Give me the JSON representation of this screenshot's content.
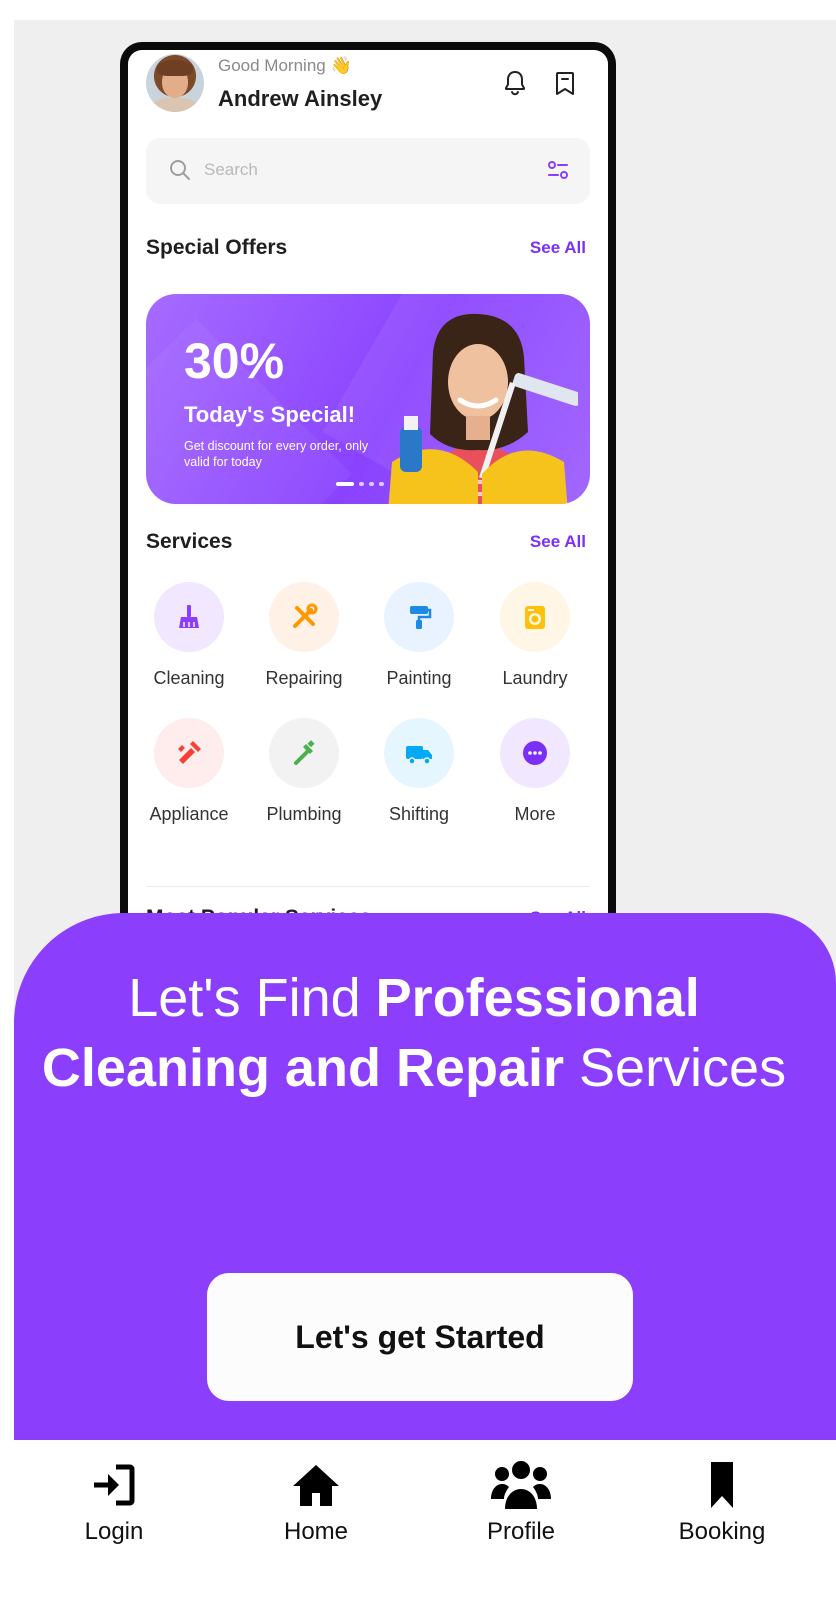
{
  "mockup": {
    "greeting": "Good Morning 👋",
    "user_name": "Andrew Ainsley",
    "search_placeholder": "Search",
    "special_offers_title": "Special Offers",
    "special_offers_see_all": "See All",
    "banner": {
      "percent": "30%",
      "title": "Today's Special!",
      "description": "Get discount for every order, only valid for today"
    },
    "services_title": "Services",
    "services_see_all": "See All",
    "services": [
      {
        "label": "Cleaning",
        "icon": "broom-icon",
        "bg": "#f1e8ff",
        "color": "#8b3ffc"
      },
      {
        "label": "Repairing",
        "icon": "tools-icon",
        "bg": "#fff1e6",
        "color": "#ff9800"
      },
      {
        "label": "Painting",
        "icon": "paint-roller-icon",
        "bg": "#e8f3ff",
        "color": "#1e88e5"
      },
      {
        "label": "Laundry",
        "icon": "washing-machine-icon",
        "bg": "#fff6e5",
        "color": "#ffc107"
      },
      {
        "label": "Appliance",
        "icon": "appliance-icon",
        "bg": "#ffecec",
        "color": "#f44336"
      },
      {
        "label": "Plumbing",
        "icon": "wrench-icon",
        "bg": "#f2f2f2",
        "color": "#4caf50"
      },
      {
        "label": "Shifting",
        "icon": "truck-icon",
        "bg": "#e6f6ff",
        "color": "#03a9f4"
      },
      {
        "label": "More",
        "icon": "more-icon",
        "bg": "#f1e8ff",
        "color": "#7b2ff7"
      }
    ],
    "popular_title": "Most Popular Services",
    "popular_see_all": "See All"
  },
  "hero": {
    "line1_regular": "Let's Find ",
    "line1_bold": "Professional",
    "line2_bold": "Cleaning and Repair",
    "line2_regular": " Services",
    "cta_label": "Let's get Started"
  },
  "nav": [
    {
      "label": "Login",
      "icon": "login-icon"
    },
    {
      "label": "Home",
      "icon": "home-icon"
    },
    {
      "label": "Profile",
      "icon": "users-icon"
    },
    {
      "label": "Booking",
      "icon": "bookmark-icon"
    }
  ],
  "colors": {
    "accent": "#8b3ffc",
    "link": "#7b2ff7"
  }
}
